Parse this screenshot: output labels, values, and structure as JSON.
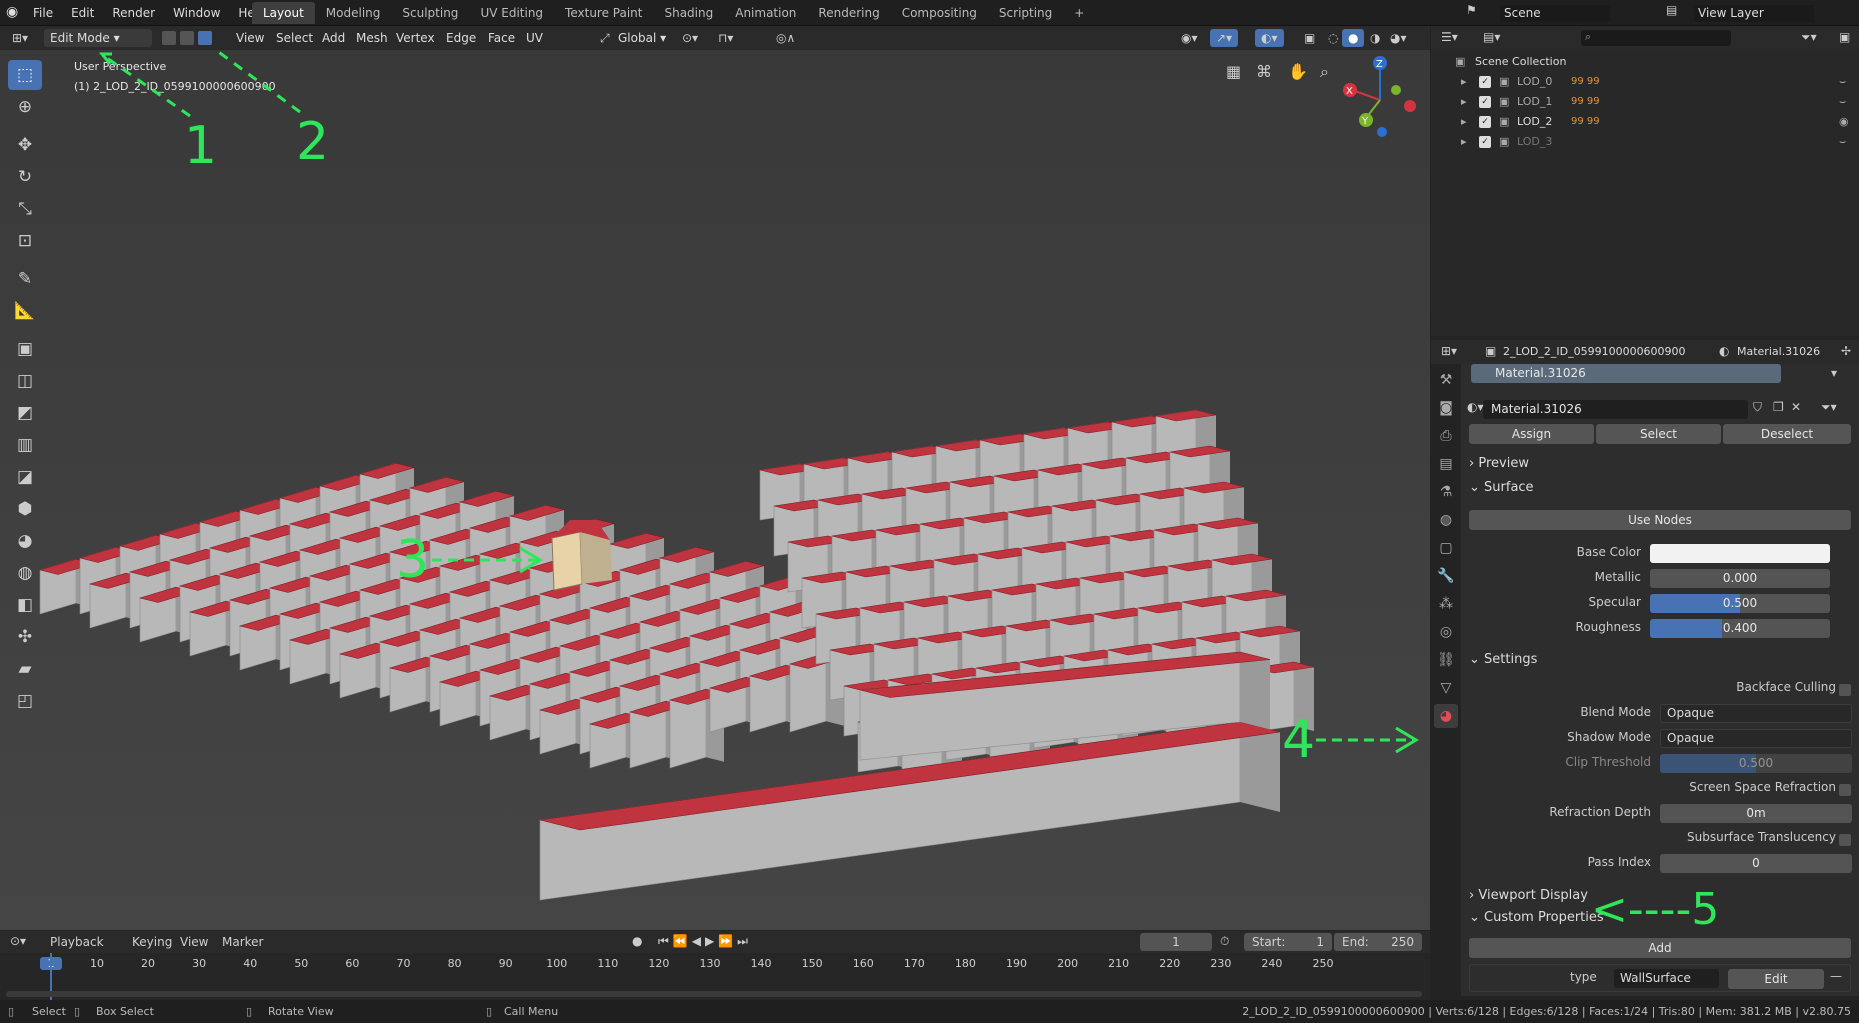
{
  "topbar": {
    "logo": "blender-icon",
    "menus": [
      "File",
      "Edit",
      "Render",
      "Window",
      "Help"
    ],
    "tabs": [
      "Layout",
      "Modeling",
      "Sculpting",
      "UV Editing",
      "Texture Paint",
      "Shading",
      "Animation",
      "Rendering",
      "Compositing",
      "Scripting"
    ],
    "scene": "Scene",
    "view_layer": "View Layer",
    "add_tab": "+"
  },
  "viewport": {
    "mode": "Edit Mode",
    "menus": [
      "View",
      "Select",
      "Add",
      "Mesh",
      "Vertex",
      "Edge",
      "Face",
      "UV"
    ],
    "orientation": "Global",
    "overlay_title": "User Perspective",
    "overlay_object": "(1) 2_LOD_2_ID_0599100000600900",
    "gizmo": {
      "z": "Z",
      "y": "Y",
      "x": "X"
    }
  },
  "annotations": [
    "1",
    "2",
    "3",
    "4",
    "5"
  ],
  "outliner": {
    "title": "Scene Collection",
    "items": [
      {
        "label": "LOD_0",
        "badge": "99 99"
      },
      {
        "label": "LOD_1",
        "badge": "99 99"
      },
      {
        "label": "LOD_2",
        "badge": "99 99"
      },
      {
        "label": "LOD_3",
        "badge": ""
      }
    ]
  },
  "properties": {
    "object": "2_LOD_2_ID_0599100000600900",
    "material": "Material.31026",
    "slot": "Material.31026",
    "assign": "Assign",
    "select": "Select",
    "deselect": "Deselect",
    "preview": "Preview",
    "surface": "Surface",
    "use_nodes": "Use Nodes",
    "base_color_label": "Base Color",
    "metallic_label": "Metallic",
    "metallic": "0.000",
    "metallic_val": 0.0,
    "specular_label": "Specular",
    "specular": "0.500",
    "specular_val": 0.5,
    "roughness_label": "Roughness",
    "roughness": "0.400",
    "roughness_val": 0.4,
    "settings": "Settings",
    "backface": "Backface Culling",
    "blend_label": "Blend Mode",
    "blend": "Opaque",
    "shadow_label": "Shadow Mode",
    "shadow": "Opaque",
    "clip_label": "Clip Threshold",
    "clip": "0.500",
    "clip_val": 0.5,
    "ssr": "Screen Space Refraction",
    "refr_label": "Refraction Depth",
    "refr": "0m",
    "sss": "Subsurface Translucency",
    "pass_label": "Pass Index",
    "pass": "0",
    "viewport_display": "Viewport Display",
    "custom_props": "Custom Properties",
    "add": "Add",
    "prop_name": "type",
    "prop_value": "WallSurface",
    "edit": "Edit"
  },
  "timeline": {
    "menus": [
      "Playback",
      "Keying",
      "View",
      "Marker"
    ],
    "frame": "1",
    "start_label": "Start:",
    "start": "1",
    "end_label": "End:",
    "end": "250",
    "ticks": [
      "1",
      "10",
      "20",
      "30",
      "40",
      "50",
      "60",
      "70",
      "80",
      "90",
      "100",
      "110",
      "120",
      "130",
      "140",
      "150",
      "160",
      "170",
      "180",
      "190",
      "200",
      "210",
      "220",
      "230",
      "240",
      "250"
    ]
  },
  "status": {
    "select": "Select",
    "box": "Box Select",
    "rotate": "Rotate View",
    "call": "Call Menu",
    "info": "2_LOD_2_ID_0599100000600900 | Verts:6/128 | Edges:6/128 | Faces:1/24 | Tris:80 | Mem: 381.2 MB | v2.80.75"
  },
  "colors": {
    "roof": "#c0343f",
    "wall": "#b8b8b8",
    "accent": "#4772b3",
    "annot": "#2ee65a"
  }
}
